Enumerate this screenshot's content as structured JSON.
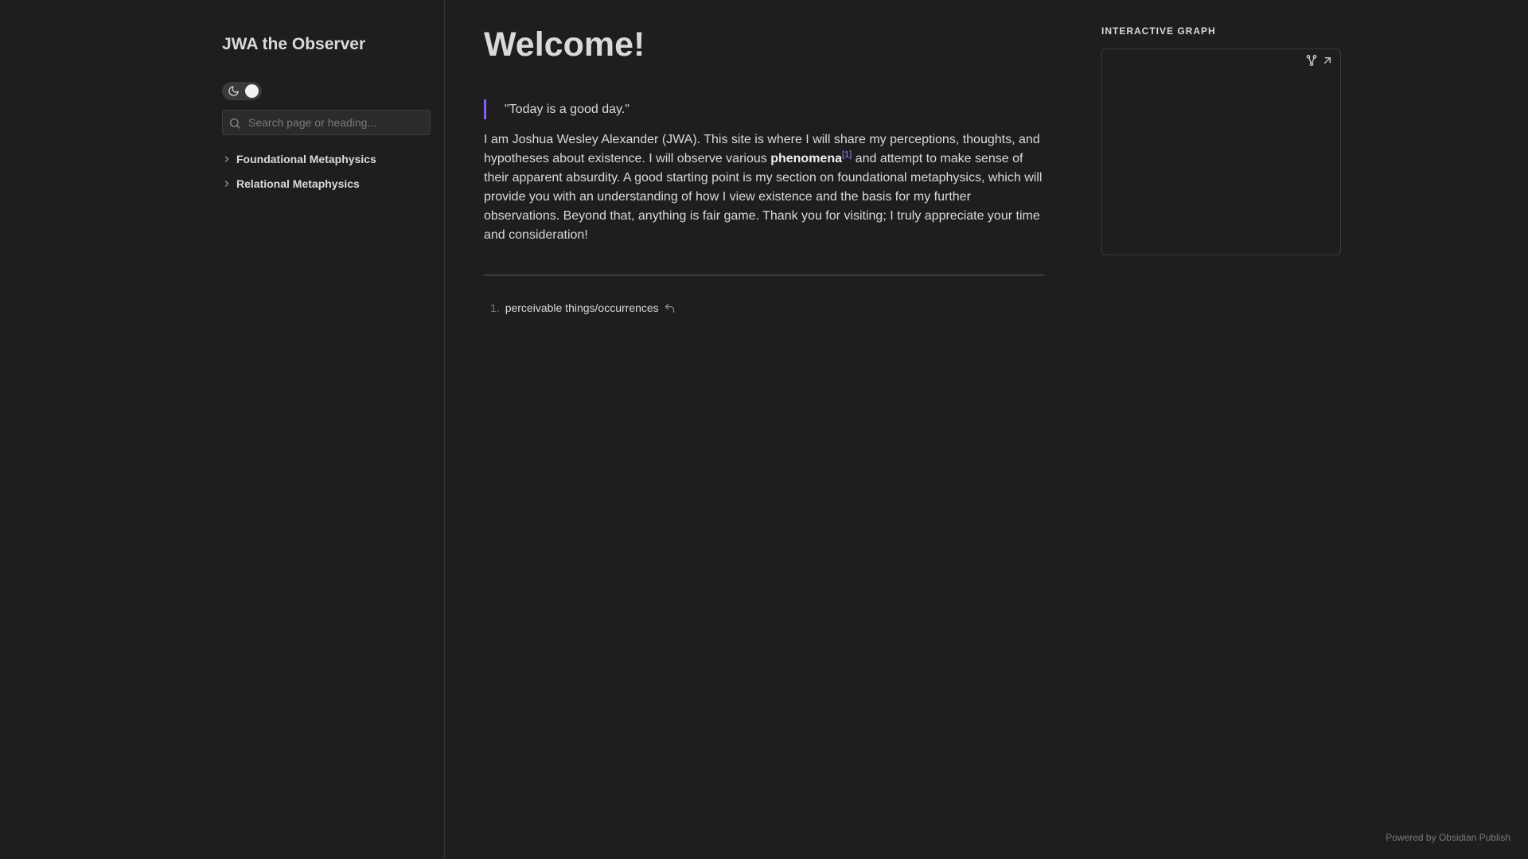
{
  "sidebar": {
    "site_name": "JWA the Observer",
    "search": {
      "placeholder": "Search page or heading..."
    },
    "nav_items": [
      {
        "label": "Foundational Metaphysics",
        "icon": "chevron-right-icon"
      },
      {
        "label": "Relational Metaphysics",
        "icon": "chevron-right-icon"
      }
    ]
  },
  "main": {
    "title": "Welcome!",
    "quote": "\"Today is a good day.\"",
    "intro": {
      "before_bold": "I am Joshua Wesley Alexander (JWA). This site is where I will share my perceptions, thoughts, and hypotheses about existence. I will observe various ",
      "bold": "phenomena",
      "footnote_ref": "[1]",
      "after_bold": " and attempt to make sense of their apparent absurdity. A good starting point is my section on foundational metaphysics, which will provide you with an understanding of how I view existence and the basis for my further observations. Beyond that, anything is fair game. Thank you for visiting; I truly appreciate your time and consideration!"
    },
    "footnotes": [
      {
        "number": "1.",
        "text": "perceivable things/occurrences"
      }
    ]
  },
  "graph": {
    "heading": "INTERACTIVE GRAPH"
  },
  "footer": {
    "powered_by": "Powered by Obsidian Publish"
  },
  "colors": {
    "background": "#1e1e1e",
    "accent": "#8a5cf5",
    "footnote_link": "#9d85ff",
    "text": "#dadada"
  }
}
